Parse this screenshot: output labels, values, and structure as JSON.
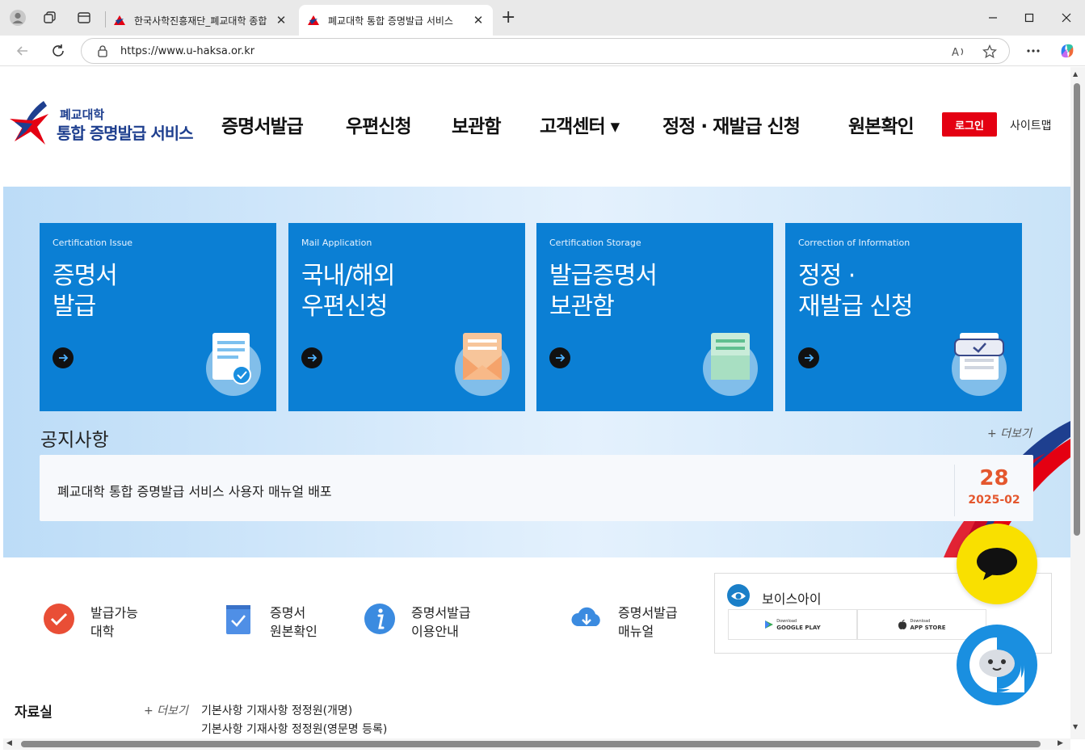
{
  "browser": {
    "tabs": [
      {
        "title": "한국사학진흥재단_폐교대학 종합",
        "active": false
      },
      {
        "title": "폐교대학 통합 증명발급 서비스",
        "active": true
      }
    ],
    "url": "https://www.u-haksa.or.kr",
    "new_tab_label": "+",
    "tab_close_label": "✕"
  },
  "header": {
    "logo_line1": "폐교대학",
    "logo_line2": "통합 증명발급 서비스",
    "nav": [
      {
        "label": "증명서발급"
      },
      {
        "label": "우편신청"
      },
      {
        "label": "보관함"
      },
      {
        "label": "고객센터 ▾"
      },
      {
        "label": "정정 · 재발급 신청"
      },
      {
        "label": "원본확인"
      }
    ],
    "login_label": "로그인",
    "sitemap_label": "사이트맵"
  },
  "cards": [
    {
      "en": "Certification Issue",
      "ko1": "증명서",
      "ko2": "발급",
      "icon": "document-check-icon"
    },
    {
      "en": "Mail Application",
      "ko1": "국내/해외",
      "ko2": "우편신청",
      "icon": "envelope-icon"
    },
    {
      "en": "Certification Storage",
      "ko1": "발급증명서",
      "ko2": "보관함",
      "icon": "folder-document-icon"
    },
    {
      "en": "Correction of Information",
      "ko1": "정정 ·",
      "ko2": "재발급 신청",
      "icon": "checkbox-document-icon"
    }
  ],
  "notice": {
    "title": "공지사항",
    "more": "+ 더보기",
    "items": [
      {
        "text": "폐교대학 통합 증명발급 서비스 사용자 매뉴얼 배포",
        "day": "28",
        "ym": "2025-02"
      }
    ]
  },
  "quick_links": [
    {
      "line1": "발급가능",
      "line2": "대학",
      "icon": "check-circle-icon"
    },
    {
      "line1": "증명서",
      "line2": "원본확인",
      "icon": "checkbox-icon"
    },
    {
      "line1": "증명서발급",
      "line2": "이용안내",
      "icon": "info-icon"
    },
    {
      "line1": "증명서발급",
      "line2": "매뉴얼",
      "icon": "cloud-download-icon"
    }
  ],
  "voice": {
    "title": "보이스아이",
    "google_small": "Download",
    "google_big": "GOOGLE PLAY",
    "apple_small": "Download",
    "apple_big": "APP STORE"
  },
  "pds": {
    "title": "자료실",
    "more": "+ 더보기",
    "items": [
      "기본사항 기재사항 정정원(개명)",
      "기본사항 기재사항 정정원(영문명 등록)"
    ]
  },
  "colors": {
    "card_blue": "#0b7fd4",
    "login_red": "#e40012",
    "date_orange": "#e4572e",
    "kakao_yellow": "#f9e000",
    "chatbot_blue": "#1a8fe0",
    "logo_navy": "#1e3f8f"
  }
}
